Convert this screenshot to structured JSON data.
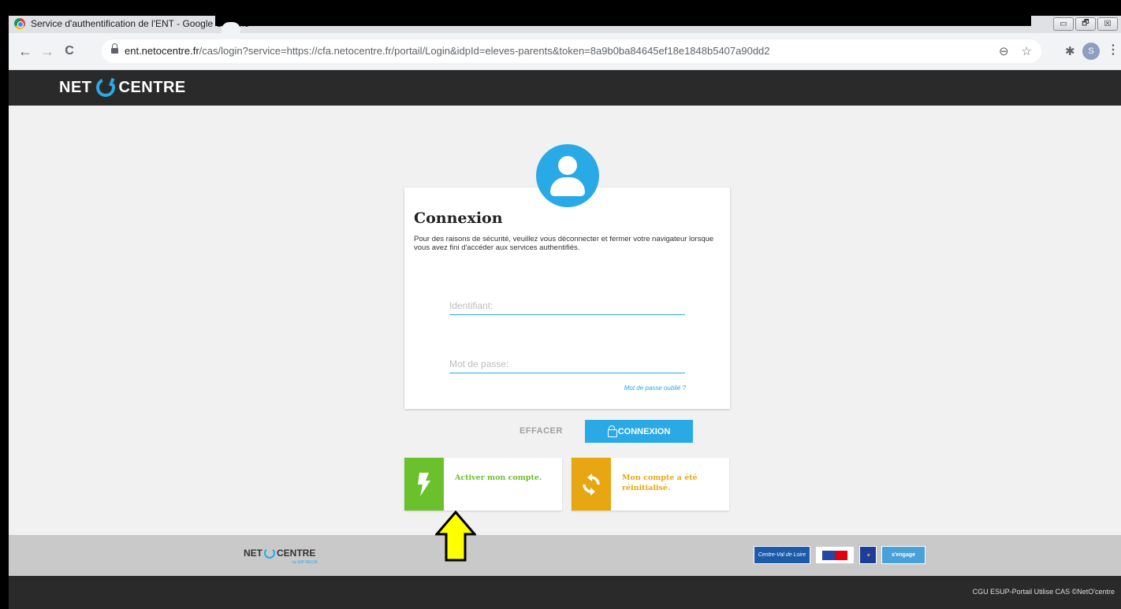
{
  "window": {
    "title": "Service d'authentification de l'ENT - Google Chrome",
    "buttons": [
      "▭",
      "🗗",
      "☒"
    ]
  },
  "browser": {
    "back": "←",
    "forward": "→",
    "reload": "C",
    "url_host": "ent.netocentre.fr",
    "url_path": "/cas/login?service=https://cfa.netocentre.fr/portail/Login&idpId=eleves-parents&token=8a9b0ba84645ef18e1848b5407a90dd2",
    "zoom_icon": "⊖",
    "star_icon": "☆",
    "extensions_icon": "✱",
    "profile_initial": "S",
    "menu_icon": "⋮"
  },
  "header": {
    "logo_left": "NET",
    "logo_right": "CENTRE"
  },
  "login": {
    "title": "Connexion",
    "notice": "Pour des raisons de sécurité, veuillez vous déconnecter et fermer votre navigateur lorsque vous avez fini d'accéder aux services authentifiés.",
    "username_placeholder": "Identifiant:",
    "password_placeholder": "Mot de passe:",
    "forgot_label": "Mot de passe oublié ?",
    "clear_label": "EFFACER",
    "submit_label": "CONNEXION"
  },
  "tiles": {
    "activate": {
      "label": "Activer mon compte.",
      "color": "#6ac12c",
      "icon": "bolt-icon"
    },
    "reset": {
      "label": "Mon compte a été réinitialisé.",
      "color": "#e8a712",
      "icon": "refresh-icon"
    }
  },
  "footer": {
    "logo_left": "NET",
    "logo_right": "CENTRE",
    "logo_by": "by GIP RECIA",
    "partner_region": "Centre-Val de Loire",
    "partner_engage": "s'engage"
  },
  "bottom": {
    "credits": "CGU ESUP-Portail Utilise CAS ©NetO'centre"
  },
  "colors": {
    "accent": "#29a9e6",
    "green": "#6ac12c",
    "orange": "#e8a712",
    "arrow": "#ffff00"
  }
}
